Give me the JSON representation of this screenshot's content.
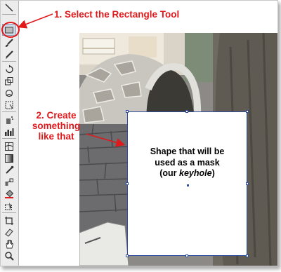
{
  "annotations": {
    "step1": "1. Select the Rectangle Tool",
    "step2_line1": "2. Create",
    "step2_line2": "something",
    "step2_line3": "like that"
  },
  "shape": {
    "line1": "Shape that will be",
    "line2": "used as a mask",
    "line3_open": "(our ",
    "line3_em": "keyhole",
    "line3_close": ")"
  },
  "toolbox": {
    "tools": [
      "line-segment-tool",
      "rectangle-tool",
      "paintbrush-tool",
      "pencil-tool",
      "rotate-tool",
      "scale-tool",
      "warp-tool",
      "free-transform-tool",
      "symbol-sprayer-tool",
      "column-graph-tool",
      "mesh-tool",
      "gradient-tool",
      "eyedropper-tool",
      "blend-tool",
      "live-paint-bucket-tool",
      "live-paint-selection-tool",
      "crop-area-tool",
      "slice-tool",
      "eraser-tool",
      "hand-tool",
      "zoom-tool"
    ],
    "selected": "rectangle-tool"
  },
  "colors": {
    "annotation": "#e0191b",
    "selection": "#2f4f9e"
  }
}
